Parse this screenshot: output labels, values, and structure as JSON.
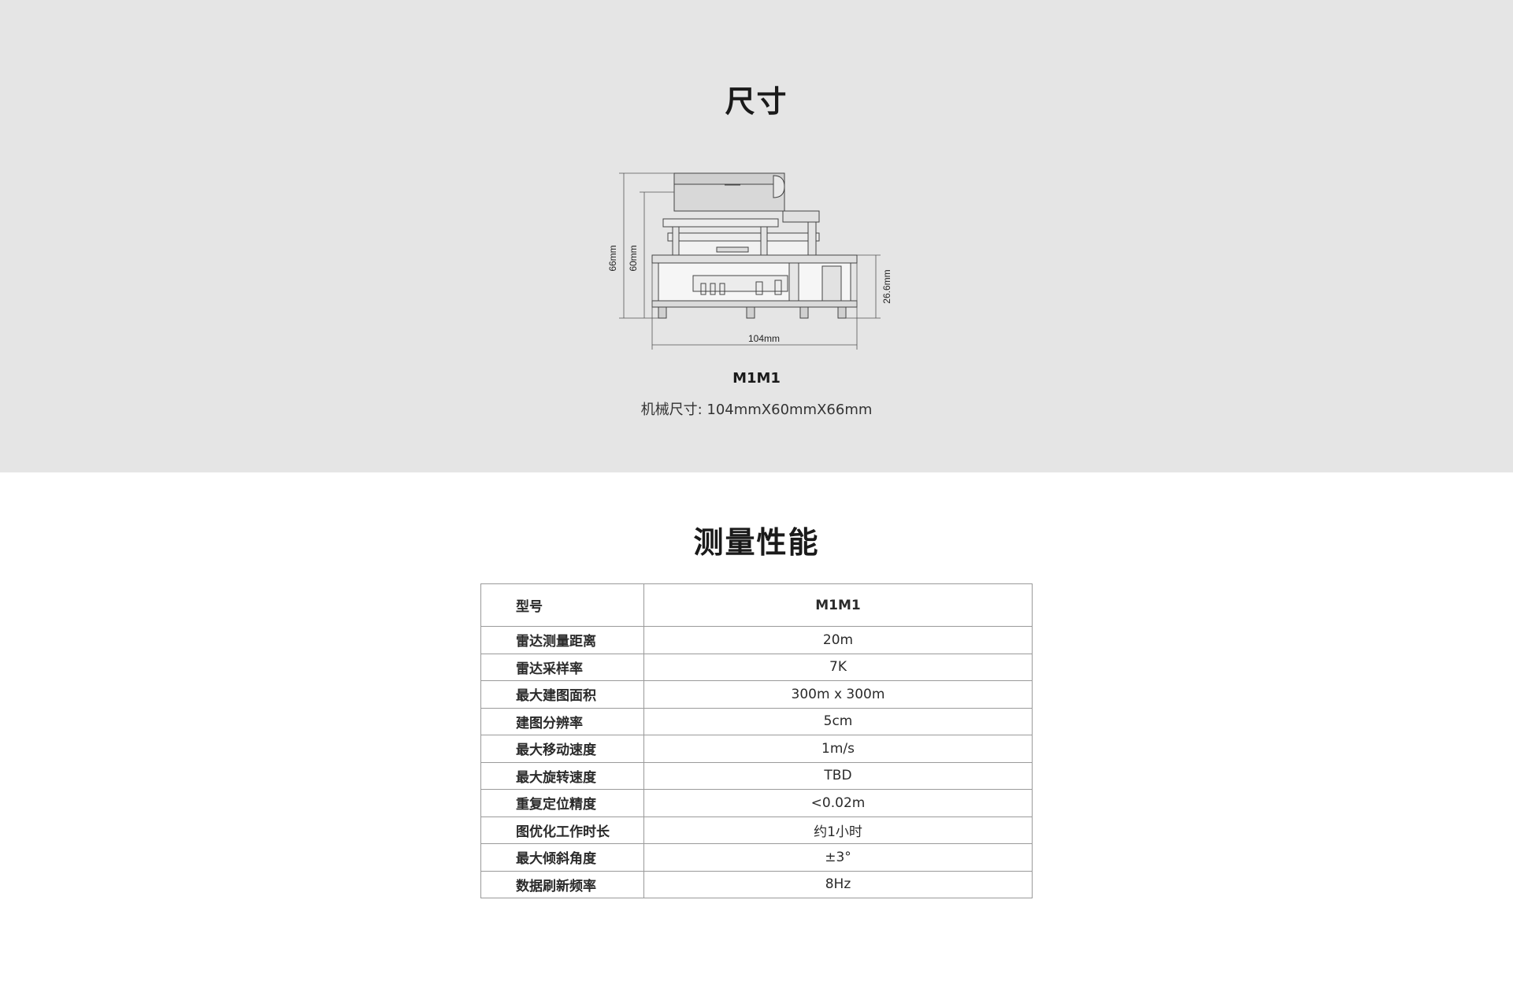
{
  "dimensions_section": {
    "title": "尺寸",
    "drawing": {
      "label_height_total": "66mm",
      "label_height_body": "60mm",
      "label_height_base": "26.6mm",
      "label_width": "104mm"
    },
    "model_name": "M1M1",
    "model_dims": "机械尺寸: 104mmX60mmX66mm"
  },
  "performance_section": {
    "title": "测量性能",
    "header": {
      "label": "型号",
      "value": "M1M1"
    },
    "rows": [
      {
        "label": "雷达测量距离",
        "value": "20m"
      },
      {
        "label": "雷达采样率",
        "value": "7K"
      },
      {
        "label": "最大建图面积",
        "value": "300m x 300m"
      },
      {
        "label": "建图分辨率",
        "value": "5cm"
      },
      {
        "label": "最大移动速度",
        "value": "1m/s"
      },
      {
        "label": "最大旋转速度",
        "value": "TBD"
      },
      {
        "label": "重复定位精度",
        "value": "<0.02m"
      },
      {
        "label": "图优化工作时长",
        "value": "约1小时"
      },
      {
        "label": "最大倾斜角度",
        "value": "±3°"
      },
      {
        "label": "数据刷新频率",
        "value": "8Hz"
      }
    ]
  },
  "colors": {
    "top_background": "#e5e5e5",
    "page_background": "#ffffff",
    "table_border": "#9a9a9a",
    "text": "#222222"
  }
}
